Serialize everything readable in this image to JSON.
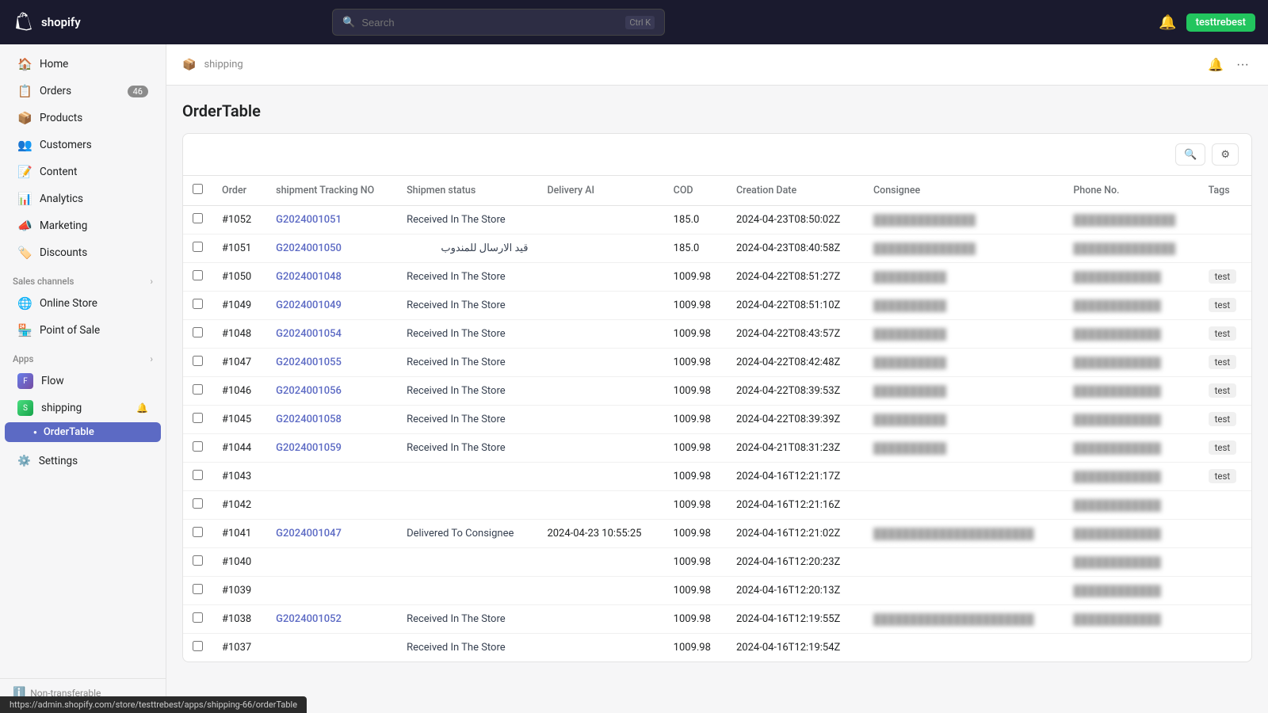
{
  "topbar": {
    "logo_text": "shopify",
    "search_placeholder": "Search",
    "search_shortcut": "Ctrl K",
    "username": "testtrebest"
  },
  "sidebar": {
    "nav_items": [
      {
        "id": "home",
        "label": "Home",
        "icon": "🏠",
        "badge": null
      },
      {
        "id": "orders",
        "label": "Orders",
        "icon": "📋",
        "badge": "46"
      },
      {
        "id": "products",
        "label": "Products",
        "icon": "📦",
        "badge": null
      },
      {
        "id": "customers",
        "label": "Customers",
        "icon": "👥",
        "badge": null
      },
      {
        "id": "content",
        "label": "Content",
        "icon": "📝",
        "badge": null
      },
      {
        "id": "analytics",
        "label": "Analytics",
        "icon": "📊",
        "badge": null
      },
      {
        "id": "marketing",
        "label": "Marketing",
        "icon": "📣",
        "badge": null
      },
      {
        "id": "discounts",
        "label": "Discounts",
        "icon": "🏷️",
        "badge": null
      }
    ],
    "sales_channels_label": "Sales channels",
    "sales_channels": [
      {
        "id": "online-store",
        "label": "Online Store"
      },
      {
        "id": "pos",
        "label": "Point of Sale"
      }
    ],
    "apps_label": "Apps",
    "apps": [
      {
        "id": "flow",
        "label": "Flow"
      }
    ],
    "shipping_app": {
      "label": "shipping",
      "sub_items": [
        {
          "id": "order-table",
          "label": "OrderTable",
          "active": true
        }
      ]
    },
    "settings_label": "Settings",
    "non_transferable": "Non-transferable"
  },
  "page": {
    "breadcrumb_icon": "📦",
    "breadcrumb_text": "shipping",
    "title": "OrderTable"
  },
  "table": {
    "columns": [
      "",
      "Order",
      "shipment Tracking NO",
      "Shipmen status",
      "Delivery AI",
      "COD",
      "Creation Date",
      "Consignee",
      "Phone No.",
      "Tags"
    ],
    "rows": [
      {
        "order": "#1052",
        "tracking": "G2024001051",
        "status": "Received In The Store",
        "delivery_ai": "",
        "cod": "185.0",
        "creation_date": "2024-04-23T08:50:02Z",
        "consignee": "██████████████",
        "phone": "██████████████",
        "tags": ""
      },
      {
        "order": "#1051",
        "tracking": "G2024001050",
        "status": "قيد الارسال للمندوب",
        "delivery_ai": "",
        "cod": "185.0",
        "creation_date": "2024-04-23T08:40:58Z",
        "consignee": "██████████████",
        "phone": "██████████████",
        "tags": ""
      },
      {
        "order": "#1050",
        "tracking": "G2024001048",
        "status": "Received In The Store",
        "delivery_ai": "",
        "cod": "1009.98",
        "creation_date": "2024-04-22T08:51:27Z",
        "consignee": "██████████",
        "phone": "████████████",
        "tags": "test"
      },
      {
        "order": "#1049",
        "tracking": "G2024001049",
        "status": "Received In The Store",
        "delivery_ai": "",
        "cod": "1009.98",
        "creation_date": "2024-04-22T08:51:10Z",
        "consignee": "██████████",
        "phone": "████████████",
        "tags": "test"
      },
      {
        "order": "#1048",
        "tracking": "G2024001054",
        "status": "Received In The Store",
        "delivery_ai": "",
        "cod": "1009.98",
        "creation_date": "2024-04-22T08:43:57Z",
        "consignee": "██████████",
        "phone": "████████████",
        "tags": "test"
      },
      {
        "order": "#1047",
        "tracking": "G2024001055",
        "status": "Received In The Store",
        "delivery_ai": "",
        "cod": "1009.98",
        "creation_date": "2024-04-22T08:42:48Z",
        "consignee": "██████████",
        "phone": "████████████",
        "tags": "test"
      },
      {
        "order": "#1046",
        "tracking": "G2024001056",
        "status": "Received In The Store",
        "delivery_ai": "",
        "cod": "1009.98",
        "creation_date": "2024-04-22T08:39:53Z",
        "consignee": "██████████",
        "phone": "████████████",
        "tags": "test"
      },
      {
        "order": "#1045",
        "tracking": "G2024001058",
        "status": "Received In The Store",
        "delivery_ai": "",
        "cod": "1009.98",
        "creation_date": "2024-04-22T08:39:39Z",
        "consignee": "██████████",
        "phone": "████████████",
        "tags": "test"
      },
      {
        "order": "#1044",
        "tracking": "G2024001059",
        "status": "Received In The Store",
        "delivery_ai": "",
        "cod": "1009.98",
        "creation_date": "2024-04-21T08:31:23Z",
        "consignee": "██████████",
        "phone": "████████████",
        "tags": "test"
      },
      {
        "order": "#1043",
        "tracking": "",
        "status": "",
        "delivery_ai": "",
        "cod": "1009.98",
        "creation_date": "2024-04-16T12:21:17Z",
        "consignee": "",
        "phone": "████████████",
        "tags": "test"
      },
      {
        "order": "#1042",
        "tracking": "",
        "status": "",
        "delivery_ai": "",
        "cod": "1009.98",
        "creation_date": "2024-04-16T12:21:16Z",
        "consignee": "",
        "phone": "████████████",
        "tags": ""
      },
      {
        "order": "#1041",
        "tracking": "G2024001047",
        "status": "Delivered To Consignee",
        "delivery_ai": "2024-04-23 10:55:25",
        "cod": "1009.98",
        "creation_date": "2024-04-16T12:21:02Z",
        "consignee": "██████████████████████",
        "phone": "████████████",
        "tags": ""
      },
      {
        "order": "#1040",
        "tracking": "",
        "status": "",
        "delivery_ai": "",
        "cod": "1009.98",
        "creation_date": "2024-04-16T12:20:23Z",
        "consignee": "",
        "phone": "████████████",
        "tags": ""
      },
      {
        "order": "#1039",
        "tracking": "",
        "status": "",
        "delivery_ai": "",
        "cod": "1009.98",
        "creation_date": "2024-04-16T12:20:13Z",
        "consignee": "",
        "phone": "████████████",
        "tags": ""
      },
      {
        "order": "#1038",
        "tracking": "G2024001052",
        "status": "Received In The Store",
        "delivery_ai": "",
        "cod": "1009.98",
        "creation_date": "2024-04-16T12:19:55Z",
        "consignee": "██████████████████████",
        "phone": "████████████",
        "tags": ""
      },
      {
        "order": "#1037",
        "tracking": "",
        "status": "Received In The Store",
        "delivery_ai": "",
        "cod": "1009.98",
        "creation_date": "2024-04-16T12:19:54Z",
        "consignee": "",
        "phone": "",
        "tags": ""
      }
    ]
  },
  "url_bar": "https://admin.shopify.com/store/testtrebest/apps/shipping-66/orderTable"
}
